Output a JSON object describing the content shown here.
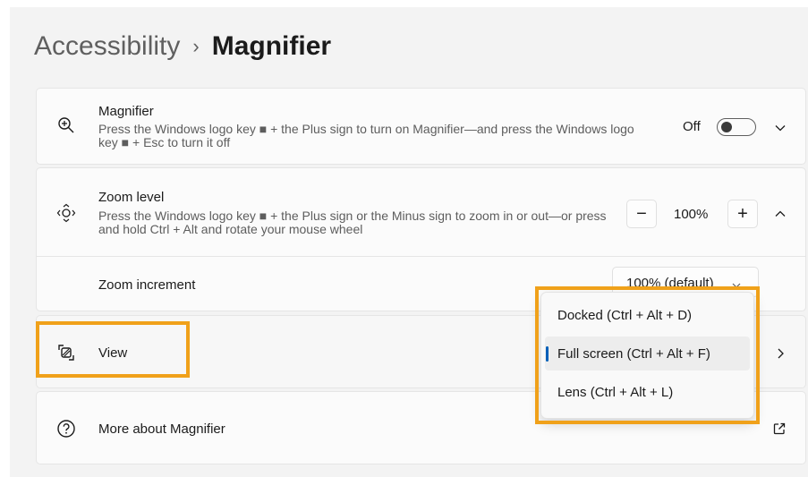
{
  "breadcrumb": {
    "parent": "Accessibility",
    "separator": "›",
    "current": "Magnifier"
  },
  "magnifier": {
    "title": "Magnifier",
    "description": "Press the Windows logo key ■ + the Plus sign to turn on Magnifier—and press the Windows logo key ■ + Esc to turn it off",
    "toggle_label": "Off",
    "toggle_on": false,
    "icon": "zoom-in-icon"
  },
  "zoom_level": {
    "title": "Zoom level",
    "description": "Press the Windows logo key ■ + the Plus sign or the Minus sign to zoom in or out—or press and hold Ctrl + Alt and rotate your mouse wheel",
    "minus": "−",
    "plus": "+",
    "value": "100%",
    "icon": "zoom-move-icon"
  },
  "zoom_increment": {
    "title": "Zoom increment",
    "selected": "100% (default)"
  },
  "view": {
    "title": "View",
    "icon": "view-icon",
    "menu": [
      {
        "label": "Docked (Ctrl + Alt + D)",
        "selected": false
      },
      {
        "label": "Full screen (Ctrl + Alt + F)",
        "selected": true
      },
      {
        "label": "Lens (Ctrl + Alt + L)",
        "selected": false
      }
    ]
  },
  "more": {
    "title": "More about Magnifier",
    "icon": "help-icon",
    "link_icon": "open-external-icon"
  },
  "colors": {
    "highlight": "#f0a11a",
    "accent": "#005fb8"
  }
}
